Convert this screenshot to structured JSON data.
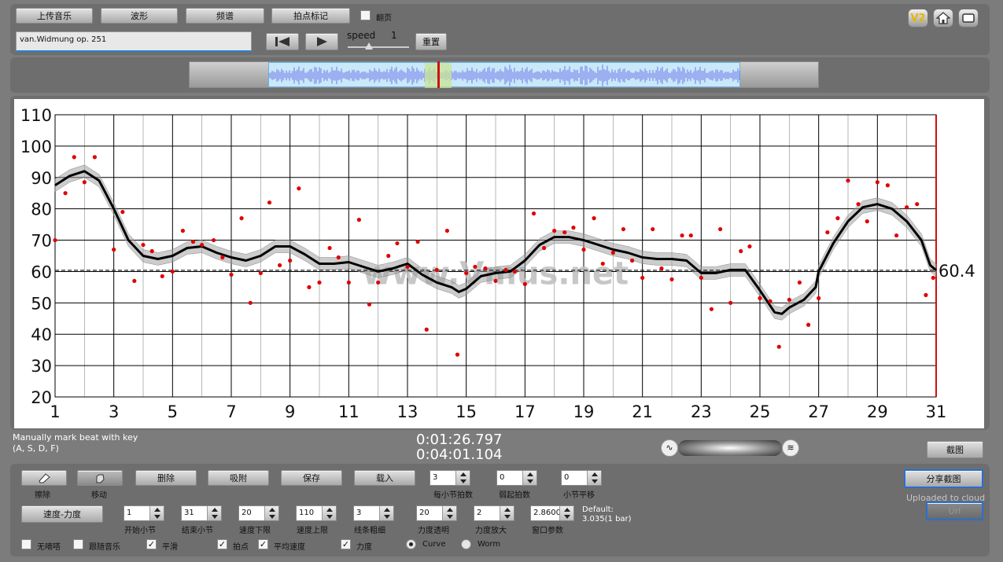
{
  "toolbar": {
    "upload": "上传音乐",
    "waveform": "波形",
    "spectrum": "频谱",
    "mark": "拍点标记",
    "page_flip": "翻页",
    "v2": "V2"
  },
  "track": {
    "title": "van.Widmung op. 251"
  },
  "playback": {
    "speed_label": "speed",
    "speed_value": "1",
    "reset": "重置"
  },
  "chart_data": {
    "type": "line",
    "xlim": [
      1,
      31
    ],
    "ylim": [
      20,
      110
    ],
    "x_ticks": [
      "1",
      "3",
      "5",
      "7",
      "9",
      "11",
      "13",
      "15",
      "17",
      "19",
      "21",
      "23",
      "25",
      "27",
      "29",
      "31"
    ],
    "y_ticks": [
      "110",
      "100",
      "90",
      "80",
      "70",
      "60",
      "50",
      "40",
      "30",
      "20"
    ],
    "mean_label": "60.4",
    "mean_value": 60.4,
    "watermark": "www.Vmus.net",
    "series": [
      {
        "values": [
          [
            1,
            87.5
          ],
          [
            1.5,
            90.5
          ],
          [
            2,
            92
          ],
          [
            2.5,
            89
          ],
          [
            3,
            80
          ],
          [
            3.5,
            70
          ],
          [
            4,
            65
          ],
          [
            4.5,
            64
          ],
          [
            5,
            65
          ],
          [
            5.5,
            67.5
          ],
          [
            6,
            68
          ],
          [
            6.5,
            66
          ],
          [
            7,
            64.5
          ],
          [
            7.5,
            63.5
          ],
          [
            8,
            65
          ],
          [
            8.5,
            68
          ],
          [
            9,
            68
          ],
          [
            9.5,
            65.5
          ],
          [
            10,
            62.5
          ],
          [
            10.5,
            62.5
          ],
          [
            11,
            63
          ],
          [
            11.5,
            61.5
          ],
          [
            12,
            60
          ],
          [
            12.5,
            61
          ],
          [
            13,
            62.5
          ],
          [
            13.5,
            59
          ],
          [
            14,
            56.5
          ],
          [
            14.5,
            55
          ],
          [
            14.75,
            53.5
          ],
          [
            15,
            54.5
          ],
          [
            15.5,
            58.5
          ],
          [
            16,
            59.5
          ],
          [
            16.5,
            60
          ],
          [
            17,
            63.5
          ],
          [
            17.5,
            68.5
          ],
          [
            18,
            71
          ],
          [
            18.5,
            71
          ],
          [
            19,
            70
          ],
          [
            19.5,
            68.5
          ],
          [
            20,
            67
          ],
          [
            20.5,
            66
          ],
          [
            21,
            64.5
          ],
          [
            21.5,
            64
          ],
          [
            22,
            64
          ],
          [
            22.5,
            63.5
          ],
          [
            23,
            59.5
          ],
          [
            23.5,
            59.5
          ],
          [
            24,
            60.5
          ],
          [
            24.5,
            60.5
          ],
          [
            25,
            54
          ],
          [
            25.5,
            47
          ],
          [
            25.75,
            46.5
          ],
          [
            26,
            48.5
          ],
          [
            26.5,
            51
          ],
          [
            26.9,
            55
          ],
          [
            27,
            60
          ],
          [
            27.5,
            69
          ],
          [
            28,
            76
          ],
          [
            28.5,
            80.5
          ],
          [
            29,
            81.5
          ],
          [
            29.5,
            80
          ],
          [
            30,
            76
          ],
          [
            30.5,
            70
          ],
          [
            30.8,
            62
          ],
          [
            31,
            60.4
          ]
        ]
      },
      {
        "values": [
          [
            1,
            70
          ],
          [
            1.35,
            85
          ],
          [
            1.65,
            96.5
          ],
          [
            2,
            88.5
          ],
          [
            2.35,
            96.5
          ],
          [
            3,
            67
          ],
          [
            3.3,
            79
          ],
          [
            3.7,
            57
          ],
          [
            4,
            68.5
          ],
          [
            4.3,
            66.5
          ],
          [
            4.65,
            58.5
          ],
          [
            5,
            60
          ],
          [
            5.35,
            73
          ],
          [
            5.7,
            69.5
          ],
          [
            6,
            68.5
          ],
          [
            6.4,
            70
          ],
          [
            6.7,
            64.5
          ],
          [
            7,
            59
          ],
          [
            7.35,
            77
          ],
          [
            7.65,
            50
          ],
          [
            8,
            59.5
          ],
          [
            8.3,
            82
          ],
          [
            8.65,
            62
          ],
          [
            9,
            63.5
          ],
          [
            9.3,
            86.5
          ],
          [
            9.65,
            55
          ],
          [
            10,
            56.5
          ],
          [
            10.35,
            67.5
          ],
          [
            10.65,
            64.5
          ],
          [
            11,
            56.5
          ],
          [
            11.35,
            76.5
          ],
          [
            11.7,
            49.5
          ],
          [
            12,
            56.5
          ],
          [
            12.35,
            65
          ],
          [
            12.65,
            69
          ],
          [
            13,
            61.5
          ],
          [
            13.35,
            69.5
          ],
          [
            13.65,
            41.5
          ],
          [
            14,
            60.5
          ],
          [
            14.35,
            73
          ],
          [
            14.7,
            33.5
          ],
          [
            15,
            59.5
          ],
          [
            15.3,
            61.5
          ],
          [
            15.65,
            61
          ],
          [
            16,
            57
          ],
          [
            16.35,
            60.5
          ],
          [
            16.65,
            60
          ],
          [
            17,
            56
          ],
          [
            17.3,
            78.5
          ],
          [
            17.65,
            67.5
          ],
          [
            18,
            73
          ],
          [
            18.35,
            72.5
          ],
          [
            18.65,
            74
          ],
          [
            19,
            67
          ],
          [
            19.35,
            77
          ],
          [
            19.65,
            62.5
          ],
          [
            20,
            66
          ],
          [
            20.35,
            73.5
          ],
          [
            20.65,
            63.5
          ],
          [
            21,
            58
          ],
          [
            21.35,
            73.5
          ],
          [
            21.65,
            61
          ],
          [
            22,
            57.5
          ],
          [
            22.35,
            71.5
          ],
          [
            22.65,
            71.5
          ],
          [
            23,
            58
          ],
          [
            23.35,
            48
          ],
          [
            23.65,
            73.5
          ],
          [
            24,
            50
          ],
          [
            24.35,
            66.5
          ],
          [
            24.65,
            68
          ],
          [
            25,
            51.5
          ],
          [
            25.35,
            50.5
          ],
          [
            25.65,
            36
          ],
          [
            26,
            51
          ],
          [
            26.35,
            56.5
          ],
          [
            26.65,
            43
          ],
          [
            27,
            51.5
          ],
          [
            27.3,
            72.5
          ],
          [
            27.65,
            77
          ],
          [
            28,
            89
          ],
          [
            28.35,
            81.5
          ],
          [
            28.65,
            76
          ],
          [
            29,
            88.5
          ],
          [
            29.35,
            87.5
          ],
          [
            29.65,
            71.5
          ],
          [
            30,
            80.5
          ],
          [
            30.35,
            81.5
          ],
          [
            30.65,
            52.5
          ],
          [
            30.9,
            58
          ]
        ]
      }
    ]
  },
  "status": {
    "hint_line1": "Manually mark beat with key",
    "hint_line2": "(A, S, D, F)",
    "time_current": "0:01:26.797",
    "time_total": "0:04:01.104",
    "screenshot": "截图",
    "share": "分享截图",
    "uploaded": "Uploaded to cloud",
    "url_button": "Url"
  },
  "controls": {
    "erase": "擦除",
    "move": "移动",
    "delete": "删除",
    "snap": "吸附",
    "save": "保存",
    "load": "载入",
    "tempo_dynamics": "速度-力度",
    "beats_per_bar": {
      "value": "3",
      "label": "每小节拍数"
    },
    "pickup": {
      "value": "0",
      "label": "弱起拍数"
    },
    "bar_shift": {
      "value": "0",
      "label": "小节平移"
    },
    "start_bar": {
      "value": "1",
      "label": "开始小节"
    },
    "end_bar": {
      "value": "31",
      "label": "结束小节"
    },
    "tempo_min": {
      "value": "20",
      "label": "速度下限"
    },
    "tempo_max": {
      "value": "110",
      "label": "速度上限"
    },
    "line_width": {
      "value": "3",
      "label": "线条粗细"
    },
    "dyn_opacity": {
      "value": "20",
      "label": "力度透明"
    },
    "dyn_scale": {
      "value": "2",
      "label": "力度放大"
    },
    "window": {
      "value": "2.8600",
      "label": "窗口参数"
    },
    "default_line1": "Default:",
    "default_line2": "3.035(1 bar)",
    "no_click": "无嘀嗒",
    "follow": "跟随音乐",
    "smooth": "平滑",
    "beats": "拍点",
    "avg_tempo": "平均速度",
    "dynamics": "力度",
    "curve": "Curve",
    "worm": "Worm"
  }
}
